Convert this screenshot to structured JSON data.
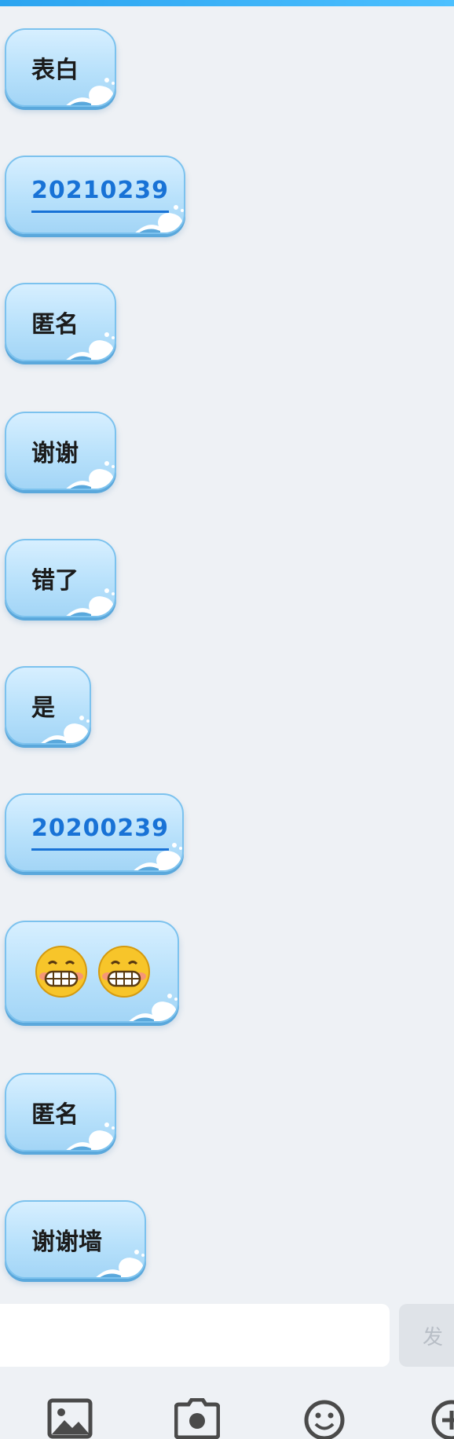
{
  "messages": [
    {
      "type": "text",
      "text": "表白"
    },
    {
      "type": "link",
      "text": "20210239"
    },
    {
      "type": "text",
      "text": "匿名"
    },
    {
      "type": "text",
      "text": "谢谢"
    },
    {
      "type": "text",
      "text": "错了"
    },
    {
      "type": "text",
      "text": "是"
    },
    {
      "type": "link",
      "text": "20200239"
    },
    {
      "type": "emoji",
      "emoji_names": [
        "grin-emoji",
        "grin-emoji"
      ]
    },
    {
      "type": "text",
      "text": "匿名"
    },
    {
      "type": "text",
      "text": "谢谢墙"
    }
  ],
  "composer": {
    "input_value": "",
    "send_label": "发"
  },
  "toolbar": {
    "icons": [
      "image-icon",
      "camera-icon",
      "emoji-icon",
      "plus-icon"
    ]
  },
  "colors": {
    "background": "#eef1f5",
    "bubble": "#b8e1fb",
    "link": "#1872d6",
    "accent_bar": "#2ba4f0"
  }
}
